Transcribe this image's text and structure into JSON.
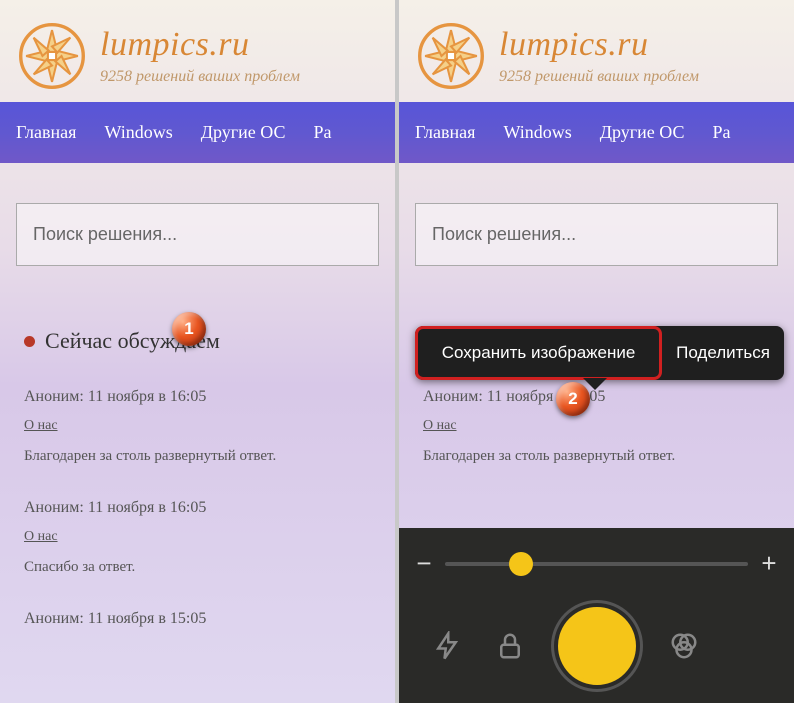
{
  "brand": {
    "title": "lumpics.ru",
    "subtitle": "9258 решений ваших проблем"
  },
  "nav": {
    "home": "Главная",
    "windows": "Windows",
    "otheros": "Другие ОС",
    "more": "Ра"
  },
  "search": {
    "placeholder": "Поиск решения..."
  },
  "discuss": {
    "heading": "Сейчас обсуждаем"
  },
  "posts": [
    {
      "meta": "Аноним: 11 ноября в 16:05",
      "link": "О нас",
      "body": "Благодарен за столь развернутый ответ."
    },
    {
      "meta": "Аноним: 11 ноября в 16:05",
      "link": "О нас",
      "body": "Спасибо за ответ."
    },
    {
      "meta": "Аноним: 11 ноября в 15:05",
      "link": "",
      "body": ""
    }
  ],
  "popup": {
    "save": "Сохранить изображение",
    "share": "Поделиться"
  },
  "markers": {
    "one": "1",
    "two": "2"
  },
  "cam": {
    "minus": "−",
    "plus": "+"
  }
}
